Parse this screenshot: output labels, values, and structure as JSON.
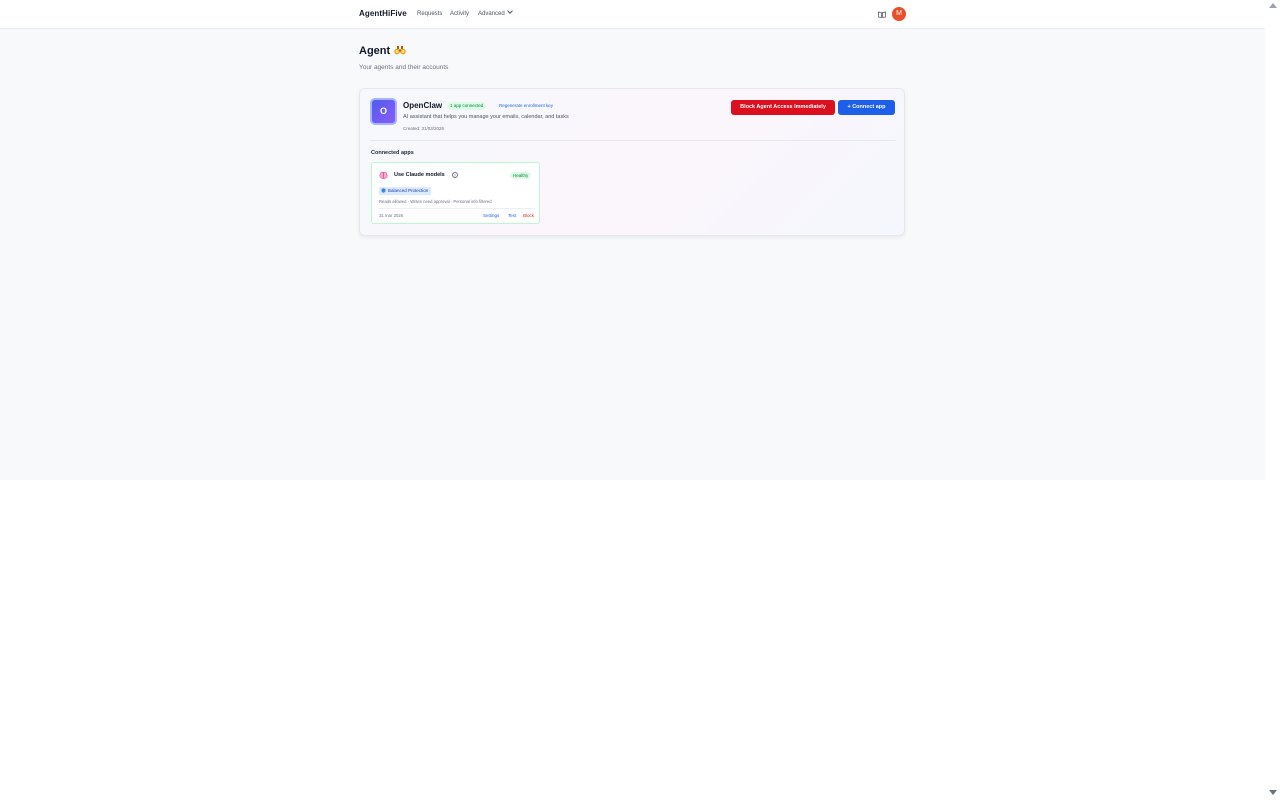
{
  "app": {
    "brand": "AgentHiFive",
    "nav": {
      "requests": "Requests",
      "activity": "Activity",
      "advanced": "Advanced"
    },
    "avatar_initial": "M",
    "icons": {
      "docs": "book-icon",
      "menu": "chevron-down-icon"
    }
  },
  "page": {
    "title": "Agent",
    "title_icon": "binoculars-icon",
    "subtitle": "Your agents and their accounts"
  },
  "agent": {
    "initial": "O",
    "name": "OpenClaw",
    "apps_badge": "1 app connected",
    "regenerate_label": "Regenerate enrollment key",
    "description": "AI assistant that helps you manage your emails, calendar, and tasks",
    "created": "Created: 31/03/2026",
    "block_button": "Block Agent Access Immediately",
    "connect_button": "+ Connect app",
    "connected_apps_heading": "Connected apps",
    "apps": [
      {
        "icon": "brain-icon",
        "name": "Use Claude models",
        "status": "Healthy",
        "protection": "Balanced Protection",
        "policy": "Reads allowed · Writes need approval · Personal info filtered",
        "date": "31 mar 2026",
        "settings_label": "Settings",
        "test_label": "Test",
        "block_label": "Block"
      }
    ]
  },
  "colors": {
    "danger": "#dc0f1e",
    "primary": "#1d5fe8",
    "success_bg": "#dcfce7",
    "success_text": "#15803d",
    "avatar": "#ea4e2a"
  }
}
